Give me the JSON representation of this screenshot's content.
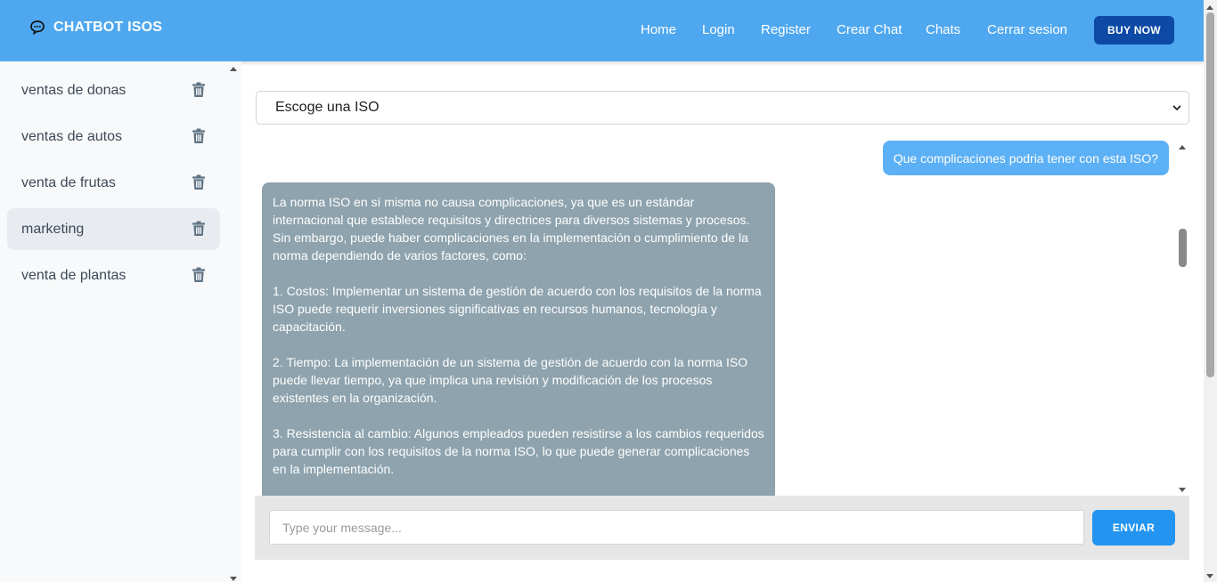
{
  "header": {
    "brand_title": "CHATBOT ISOS",
    "brand_icon": "chat-bubble-icon",
    "nav": [
      "Home",
      "Login",
      "Register",
      "Crear Chat",
      "Chats",
      "Cerrar sesion"
    ],
    "buy_label": "BUY NOW",
    "colors": {
      "header_bg": "#4fa8ef",
      "buy_bg": "#0d4aa5"
    }
  },
  "sidebar": {
    "items": [
      {
        "label": "ventas de donas",
        "active": false
      },
      {
        "label": "ventas de autos",
        "active": false
      },
      {
        "label": "venta de frutas",
        "active": false
      },
      {
        "label": "marketing",
        "active": true
      },
      {
        "label": "venta de plantas",
        "active": false
      }
    ],
    "item_icon": "trash-icon"
  },
  "main": {
    "iso_select": {
      "value": "Escoge una ISO"
    },
    "messages": {
      "user": "Que complicaciones podria tener con esta ISO?",
      "bot": [
        "La norma ISO en sí misma no causa complicaciones, ya que es un estándar internacional que establece requisitos y directrices para diversos sistemas y procesos. Sin embargo, puede haber complicaciones en la implementación o cumplimiento de la norma dependiendo de varios factores, como:",
        "1. Costos: Implementar un sistema de gestión de acuerdo con los requisitos de la norma ISO puede requerir inversiones significativas en recursos humanos, tecnología y capacitación.",
        "2. Tiempo: La implementación de un sistema de gestión de acuerdo con la norma ISO puede llevar tiempo, ya que implica una revisión y modificación de los procesos existentes en la organización.",
        "3. Resistencia al cambio: Algunos empleados pueden resistirse a los cambios requeridos para cumplir con los requisitos de la norma ISO, lo que puede generar complicaciones en la implementación."
      ]
    },
    "input": {
      "placeholder": "Type your message...",
      "value": ""
    },
    "send_label": "ENVIAR",
    "colors": {
      "user_bubble": "#5cb0f5",
      "bot_bubble": "#8ea3ad",
      "send_bg": "#2395f0"
    }
  }
}
